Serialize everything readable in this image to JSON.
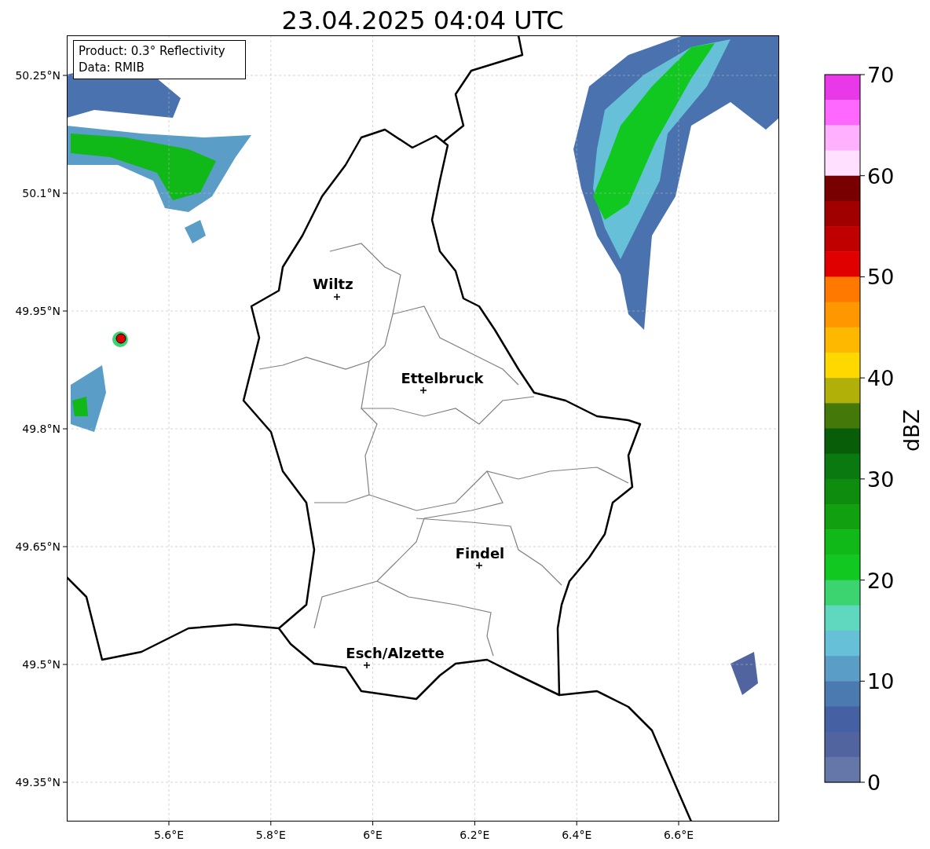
{
  "title": "23.04.2025 04:04 UTC",
  "legend": [
    "Product: 0.3° Reflectivity",
    "Data: RMIB"
  ],
  "cities": [
    {
      "name": "Wiltz"
    },
    {
      "name": "Ettelbruck"
    },
    {
      "name": "Findel"
    },
    {
      "name": "Esch/Alzette"
    }
  ],
  "x_ticks": [
    "5.6°E",
    "5.8°E",
    "6°E",
    "6.2°E",
    "6.4°E",
    "6.6°E"
  ],
  "y_ticks": [
    "50.25°N",
    "50.1°N",
    "49.95°N",
    "49.8°N",
    "49.65°N",
    "49.5°N",
    "49.35°N"
  ],
  "colorbar": {
    "label": "dBZ",
    "ticks": [
      "70",
      "60",
      "50",
      "40",
      "30",
      "20",
      "10",
      "0"
    ],
    "segments": [
      {
        "color": "#e838e8"
      },
      {
        "color": "#ff68ff"
      },
      {
        "color": "#ffb0ff"
      },
      {
        "color": "#ffe0ff"
      },
      {
        "color": "#780000"
      },
      {
        "color": "#a00000"
      },
      {
        "color": "#c00000"
      },
      {
        "color": "#e00000"
      },
      {
        "color": "#ff7800"
      },
      {
        "color": "#ff9800"
      },
      {
        "color": "#ffb800"
      },
      {
        "color": "#ffd800"
      },
      {
        "color": "#b0b008"
      },
      {
        "color": "#447808"
      },
      {
        "color": "#085e08"
      },
      {
        "color": "#0a7a10"
      },
      {
        "color": "#0e8c0e"
      },
      {
        "color": "#10a010"
      },
      {
        "color": "#10b818"
      },
      {
        "color": "#10c820"
      },
      {
        "color": "#3cd470"
      },
      {
        "color": "#60d8c0"
      },
      {
        "color": "#65c0d8"
      },
      {
        "color": "#5a9ec8"
      },
      {
        "color": "#4a7ab0"
      },
      {
        "color": "#4560a3"
      },
      {
        "color": "#52649f"
      },
      {
        "color": "#6577a8"
      }
    ]
  }
}
